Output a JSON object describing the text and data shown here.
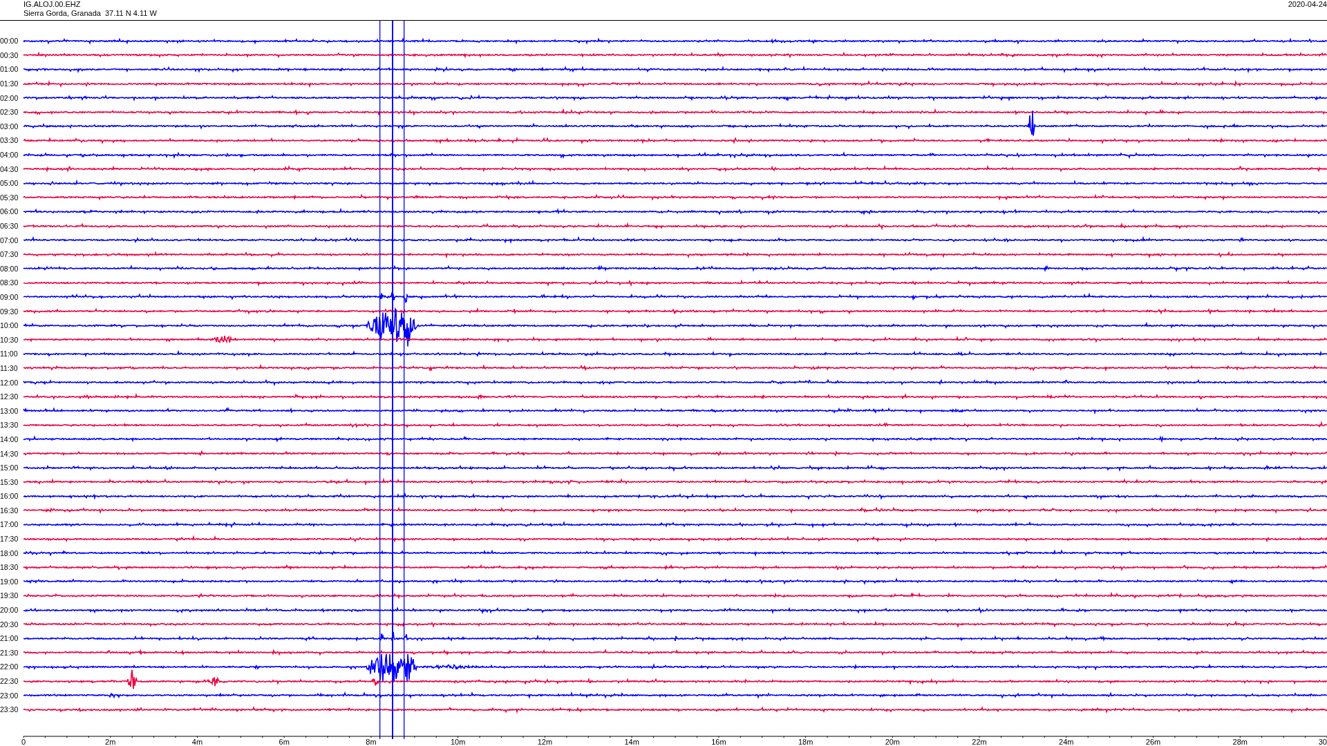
{
  "header": {
    "station": "IG.ALOJ.00.EHZ",
    "location": "Sierra Gorda, Granada  37.11 N 4.11 W",
    "date": "2020-04-24"
  },
  "traces": [
    {
      "label": "00:00",
      "color": "#0000ff"
    },
    {
      "label": "00:30",
      "color": "#ee0040"
    },
    {
      "label": "01:00",
      "color": "#0000ff"
    },
    {
      "label": "01:30",
      "color": "#ee0040"
    },
    {
      "label": "02:00",
      "color": "#0000ff"
    },
    {
      "label": "02:30",
      "color": "#ee0040"
    },
    {
      "label": "03:00",
      "color": "#0000ff"
    },
    {
      "label": "03:30",
      "color": "#ee0040"
    },
    {
      "label": "04:00",
      "color": "#0000ff"
    },
    {
      "label": "04:30",
      "color": "#ee0040"
    },
    {
      "label": "05:00",
      "color": "#0000ff"
    },
    {
      "label": "05:30",
      "color": "#ee0040"
    },
    {
      "label": "06:00",
      "color": "#0000ff"
    },
    {
      "label": "06:30",
      "color": "#ee0040"
    },
    {
      "label": "07:00",
      "color": "#0000ff"
    },
    {
      "label": "07:30",
      "color": "#ee0040"
    },
    {
      "label": "08:00",
      "color": "#0000ff"
    },
    {
      "label": "08:30",
      "color": "#ee0040"
    },
    {
      "label": "09:00",
      "color": "#0000ff"
    },
    {
      "label": "09:30",
      "color": "#ee0040"
    },
    {
      "label": "10:00",
      "color": "#0000ff"
    },
    {
      "label": "10:30",
      "color": "#ee0040"
    },
    {
      "label": "11:00",
      "color": "#0000ff"
    },
    {
      "label": "11:30",
      "color": "#ee0040"
    },
    {
      "label": "12:00",
      "color": "#0000ff"
    },
    {
      "label": "12:30",
      "color": "#ee0040"
    },
    {
      "label": "13:00",
      "color": "#0000ff"
    },
    {
      "label": "13:30",
      "color": "#ee0040"
    },
    {
      "label": "14:00",
      "color": "#0000ff"
    },
    {
      "label": "14:30",
      "color": "#ee0040"
    },
    {
      "label": "15:00",
      "color": "#0000ff"
    },
    {
      "label": "15:30",
      "color": "#ee0040"
    },
    {
      "label": "16:00",
      "color": "#0000ff"
    },
    {
      "label": "16:30",
      "color": "#ee0040"
    },
    {
      "label": "17:00",
      "color": "#0000ff"
    },
    {
      "label": "17:30",
      "color": "#ee0040"
    },
    {
      "label": "18:00",
      "color": "#0000ff"
    },
    {
      "label": "18:30",
      "color": "#ee0040"
    },
    {
      "label": "19:00",
      "color": "#0000ff"
    },
    {
      "label": "19:30",
      "color": "#ee0040"
    },
    {
      "label": "20:00",
      "color": "#0000ff"
    },
    {
      "label": "20:30",
      "color": "#ee0040"
    },
    {
      "label": "21:00",
      "color": "#0000ff"
    },
    {
      "label": "21:30",
      "color": "#ee0040"
    },
    {
      "label": "22:00",
      "color": "#0000ff"
    },
    {
      "label": "22:30",
      "color": "#ee0040"
    },
    {
      "label": "23:00",
      "color": "#0000ff"
    },
    {
      "label": "23:30",
      "color": "#ee0040"
    }
  ],
  "x_axis": {
    "ticks": [
      "0",
      "2m",
      "4m",
      "6m",
      "8m",
      "10m",
      "12m",
      "14m",
      "16m",
      "18m",
      "20m",
      "22m",
      "24m",
      "26m",
      "28m",
      "30"
    ]
  }
}
